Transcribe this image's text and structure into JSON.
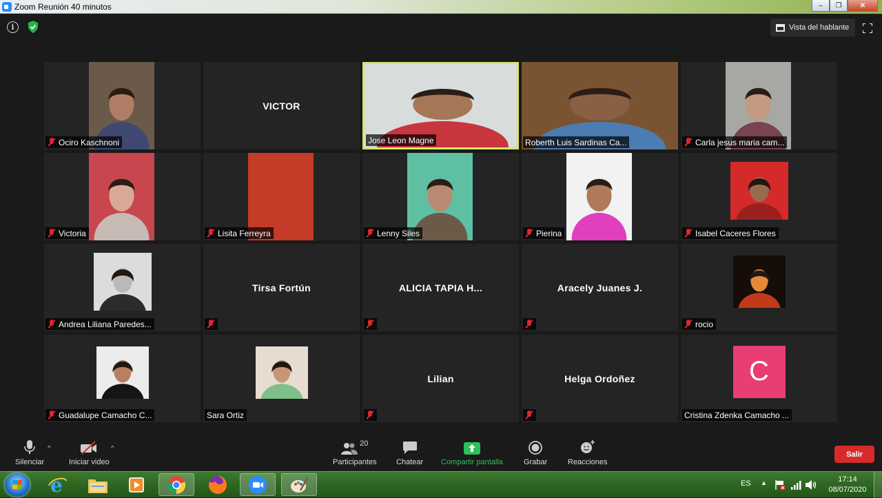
{
  "window": {
    "title": "Zoom Reunión 40 minutos"
  },
  "topbar": {
    "view_label": "Vista del hablante"
  },
  "participants": [
    {
      "name": "Ociro Kaschnoni",
      "mode": "video",
      "muted": true,
      "bg": "#6b5a4a",
      "shirt": "#3f4870",
      "skin": "#b07e66",
      "vleft": 65,
      "vwidth": 95
    },
    {
      "name": "VICTOR",
      "mode": "name",
      "muted": false
    },
    {
      "name": "Jose Leon Magne",
      "mode": "video",
      "muted": false,
      "active": true,
      "bg": "#d9dcdc",
      "shirt": "#c9353c",
      "skin": "#a57757",
      "vleft": 0,
      "vwidth": 227
    },
    {
      "name": "Roberth Luis Sardinas Ca...",
      "mode": "video",
      "muted": false,
      "bg": "#7a5432",
      "shirt": "#4b7db3",
      "skin": "#8a6045",
      "vleft": 0,
      "vwidth": 227
    },
    {
      "name": "Carla jesus maria cam...",
      "mode": "video",
      "muted": true,
      "bg": "#a7a8a4",
      "shirt": "#784450",
      "skin": "#c49a80",
      "vleft": 65,
      "vwidth": 95
    },
    {
      "name": "Victoria",
      "mode": "video",
      "muted": true,
      "bg": "#c8464d",
      "shirt": "#c7b9b4",
      "skin": "#d8aa96",
      "vleft": 65,
      "vwidth": 95
    },
    {
      "name": "Lisita Ferreyra",
      "mode": "video",
      "muted": true,
      "bg": "#c43b28",
      "shirt": "#c43b28",
      "skin": "#c43b28",
      "vleft": 65,
      "vwidth": 95,
      "blank": true
    },
    {
      "name": "Lenny Siles",
      "mode": "video",
      "muted": true,
      "bg": "#5fbfa2",
      "shirt": "#6c5a48",
      "skin": "#b88a72",
      "vleft": 65,
      "vwidth": 95
    },
    {
      "name": "Pierina",
      "mode": "video",
      "muted": true,
      "bg": "#f2f2f2",
      "shirt": "#e03fbf",
      "skin": "#b07a5a",
      "vleft": 65,
      "vwidth": 95
    },
    {
      "name": "Isabel Caceres Flores",
      "mode": "photo",
      "muted": true,
      "bg": "#d42a2a",
      "shirt": "#9a2020",
      "skin": "#9a6a50",
      "pw": 84,
      "ph": 84
    },
    {
      "name": "Andrea Liliana Paredes...",
      "mode": "photo",
      "muted": true,
      "bg": "#dcdcdc",
      "shirt": "#2b2b2b",
      "skin": "#b9b9b9",
      "pw": 84,
      "ph": 84
    },
    {
      "name": "Tirsa Fortún",
      "mode": "name",
      "muted": true
    },
    {
      "name": "ALICIA TAPIA H...",
      "mode": "name",
      "muted": true
    },
    {
      "name": "Aracely Juanes J.",
      "mode": "name",
      "muted": true
    },
    {
      "name": "rocio",
      "mode": "photo",
      "muted": true,
      "bg": "#160d08",
      "shirt": "#c23a18",
      "skin": "#e68a3a",
      "pw": 76,
      "ph": 76
    },
    {
      "name": "Guadalupe Camacho C...",
      "mode": "photo",
      "muted": true,
      "bg": "#ececec",
      "shirt": "#151515",
      "skin": "#b78064",
      "pw": 76,
      "ph": 76
    },
    {
      "name": "Sara Ortiz",
      "mode": "photo",
      "muted": false,
      "bg": "#e6ddd0",
      "shirt": "#7fbf8a",
      "skin": "#c99578",
      "pw": 76,
      "ph": 76
    },
    {
      "name": "Lilian",
      "mode": "name",
      "muted": true
    },
    {
      "name": "Helga Ordoñez",
      "mode": "name",
      "muted": true
    },
    {
      "name": "Cristina Zdenka Camacho ...",
      "mode": "initial",
      "initial": "C",
      "muted": false
    }
  ],
  "toolbar": {
    "mute_label": "Silenciar",
    "video_label": "Iniciar video",
    "participants_label": "Participantes",
    "participants_count": "20",
    "chat_label": "Chatear",
    "share_label": "Compartir pantalla",
    "record_label": "Grabar",
    "reactions_label": "Reacciones",
    "leave_label": "Salir"
  },
  "taskbar": {
    "language": "ES",
    "time": "17:14",
    "date": "08/07/2020",
    "apps": [
      "internet-explorer",
      "file-explorer",
      "media-player",
      "chrome",
      "firefox",
      "zoom",
      "paint"
    ]
  },
  "colors": {
    "active_speaker_border": "#d6e66a",
    "mute_red": "#e0262c",
    "share_green": "#2ec05a",
    "leave_red": "#d72b2b",
    "initial_pink": "#e83e74"
  }
}
